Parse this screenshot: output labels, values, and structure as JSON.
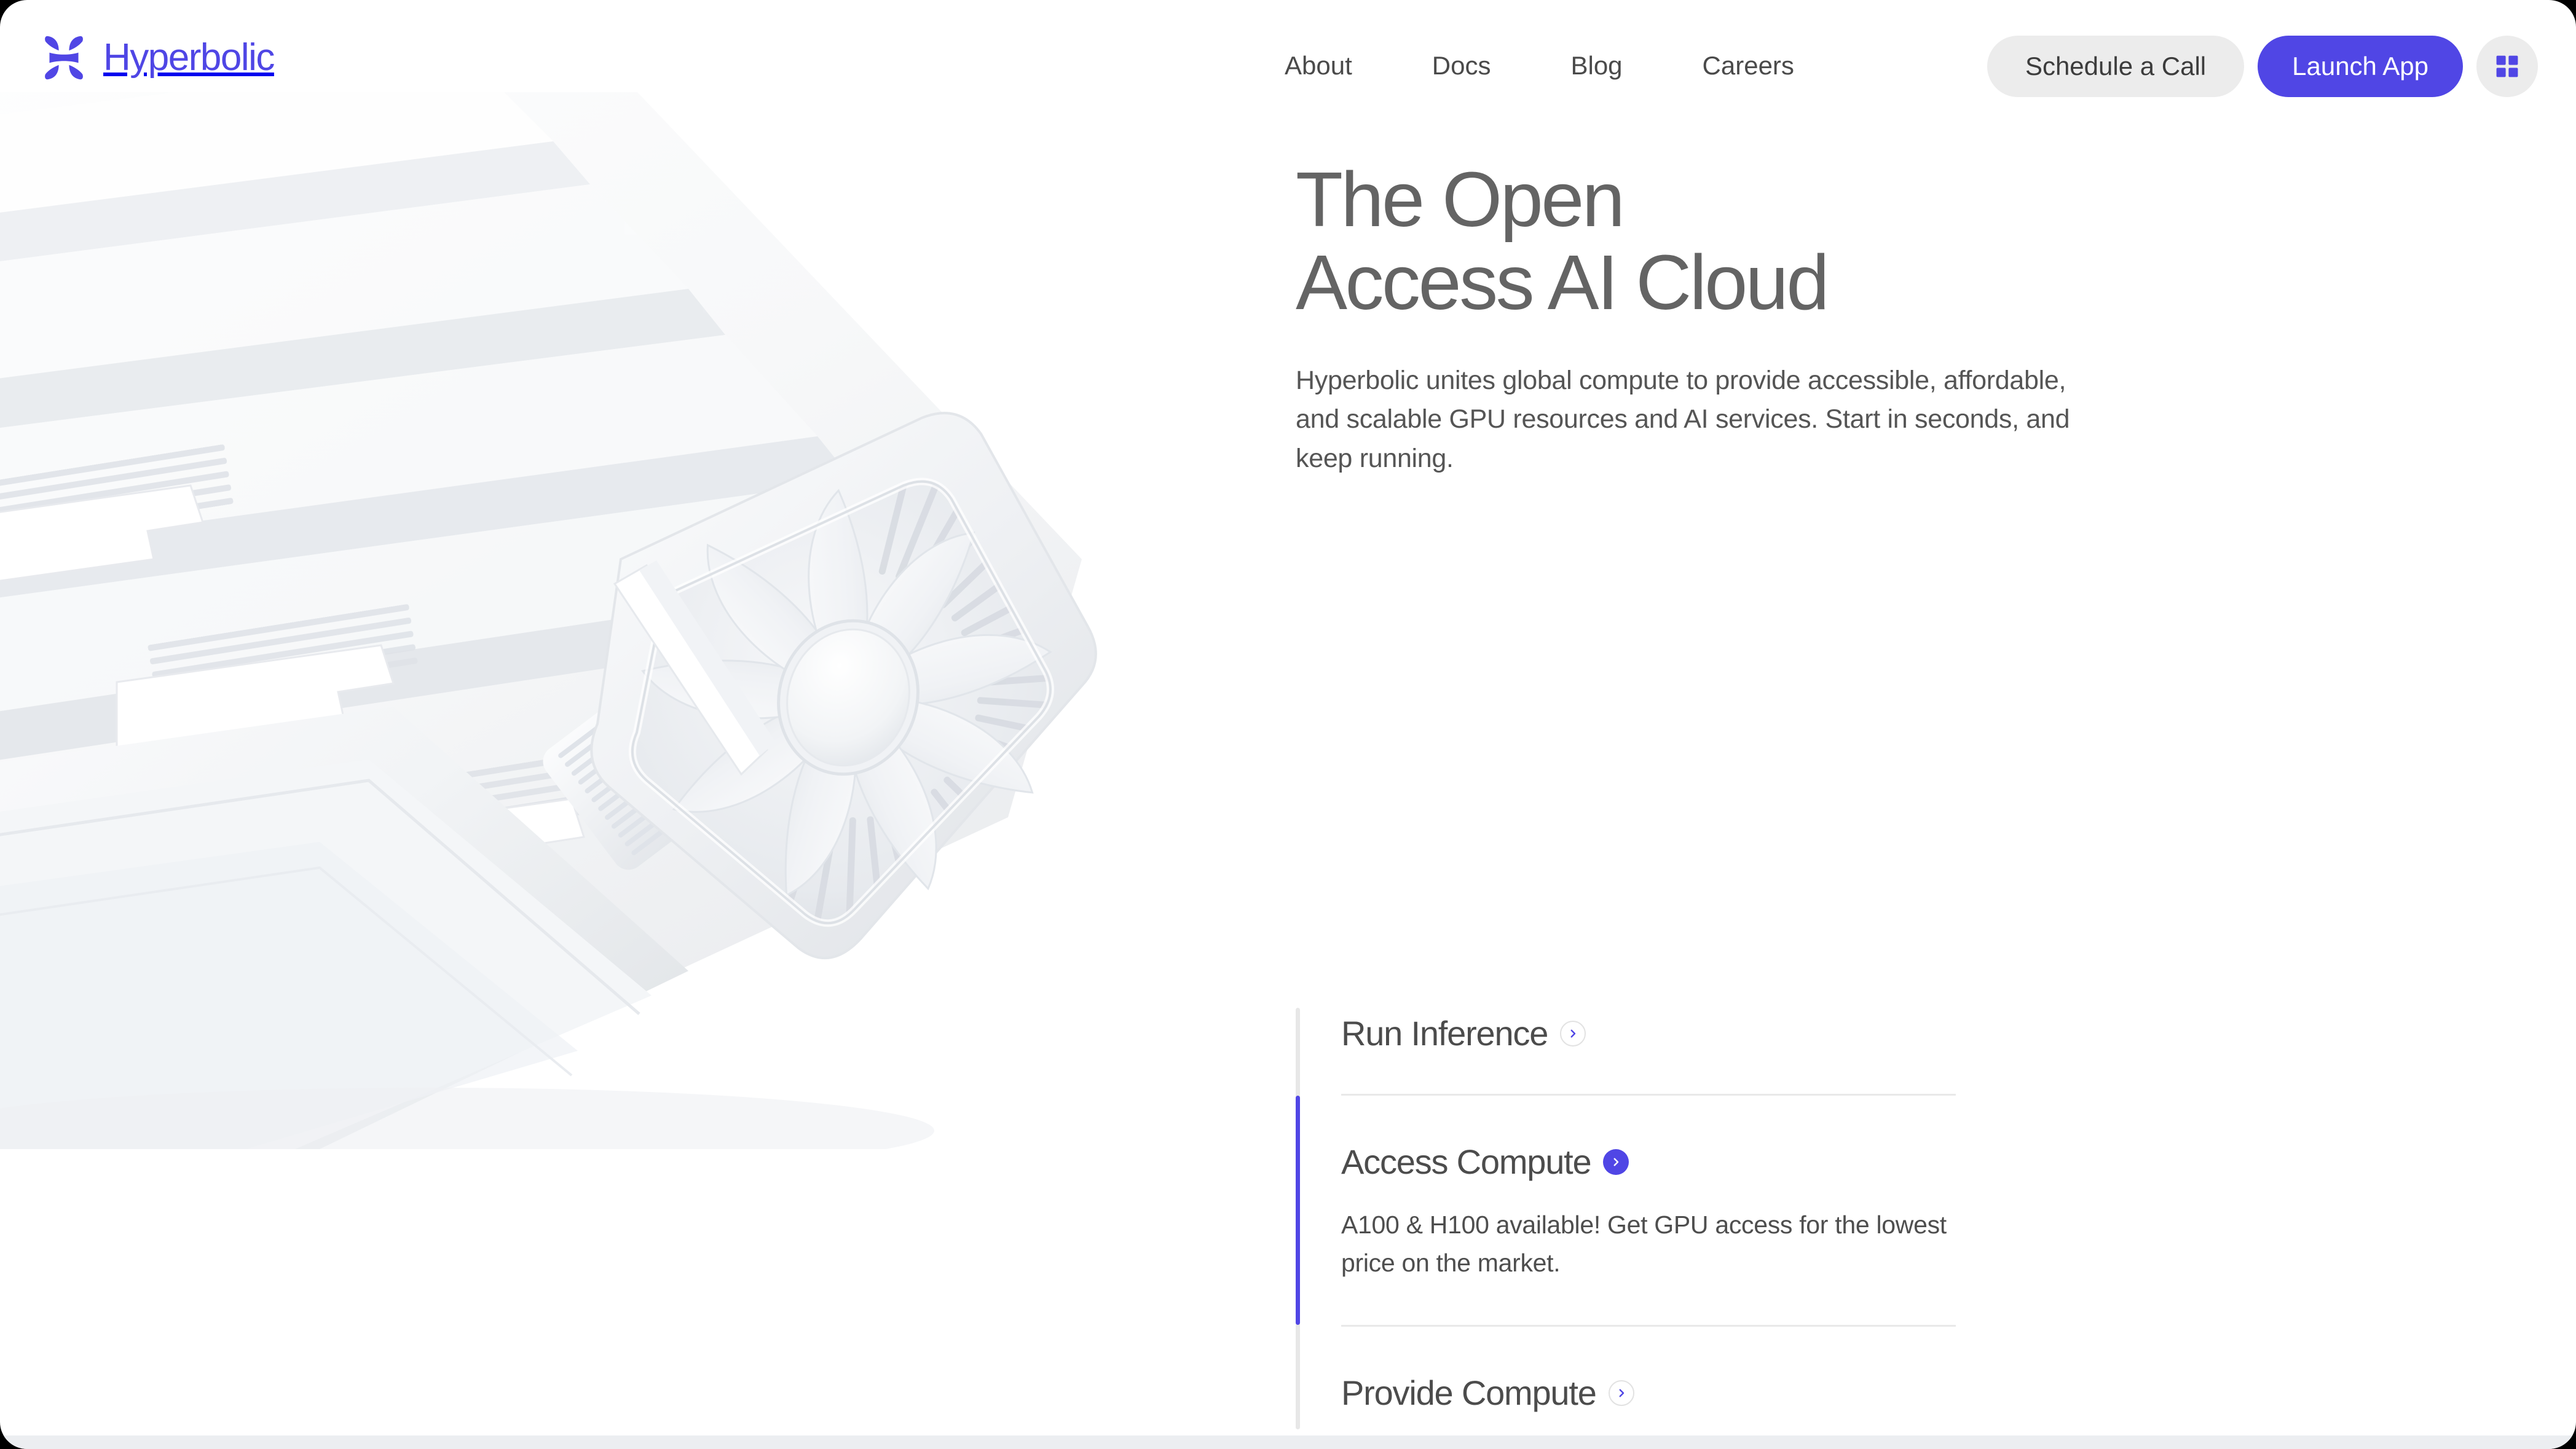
{
  "brand": {
    "name": "Hyperbolic",
    "logo_icon": "hyperbolic-h-logo",
    "accent_color": "#5046e5",
    "logo_text_color": "#4f46e5"
  },
  "nav": {
    "items": [
      {
        "label": "About"
      },
      {
        "label": "Docs"
      },
      {
        "label": "Blog"
      },
      {
        "label": "Careers"
      }
    ]
  },
  "actions": {
    "schedule_label": "Schedule a Call",
    "launch_label": "Launch App",
    "apps_icon": "grid-apps-icon"
  },
  "hero": {
    "headline": "The Open\nAccess AI Cloud",
    "subcopy": "Hyperbolic unites global compute to provide accessible, affordable, and scalable GPU resources and AI services. Start in seconds, and keep running.",
    "art_icon": "gpu-graphics-card-render"
  },
  "accordion": {
    "active_index": 1,
    "items": [
      {
        "title": "Run Inference",
        "body": "",
        "chevron_icon": "chevron-right-icon",
        "expanded": false
      },
      {
        "title": "Access Compute",
        "body": "A100 & H100 available! Get GPU access for the lowest price on the market.",
        "chevron_icon": "chevron-right-icon",
        "expanded": true
      },
      {
        "title": "Provide Compute",
        "body": "",
        "chevron_icon": "chevron-right-icon",
        "expanded": false
      }
    ]
  }
}
